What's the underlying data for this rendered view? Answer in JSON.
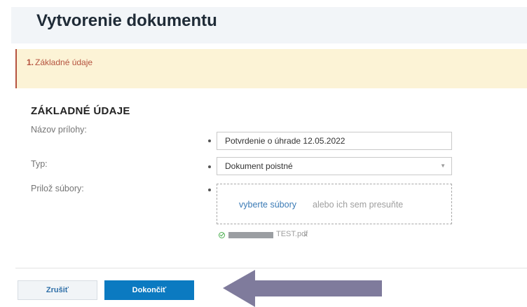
{
  "page": {
    "title": "Vytvorenie dokumentu"
  },
  "steps": [
    {
      "number": "1.",
      "label": "Základné údaje"
    }
  ],
  "section": {
    "title": "ZÁKLADNÉ ÚDAJE"
  },
  "form": {
    "attachment_name": {
      "label": "Názov prílohy:",
      "value": "Potvrdenie o úhrade 12.05.2022"
    },
    "type": {
      "label": "Typ:",
      "value": "Dokument poistné",
      "icon": "chevron-down-icon"
    },
    "files": {
      "label": "Prilož súbory:",
      "dropzone_link": "vyberte súbory",
      "dropzone_text": "alebo ich sem presuňte",
      "uploaded": [
        {
          "status_icon": "check-circle-icon",
          "name": "TEST.pdf",
          "remove_label": "×"
        }
      ]
    }
  },
  "buttons": {
    "cancel": "Zrušiť",
    "finish": "Dokončiť"
  },
  "annotation": {
    "icon": "arrow-left-icon",
    "color": "#7f7b9c"
  },
  "colors": {
    "primary": "#0b7ac1",
    "banner_bg": "#fcf3d6",
    "banner_accent": "#b5533f"
  }
}
